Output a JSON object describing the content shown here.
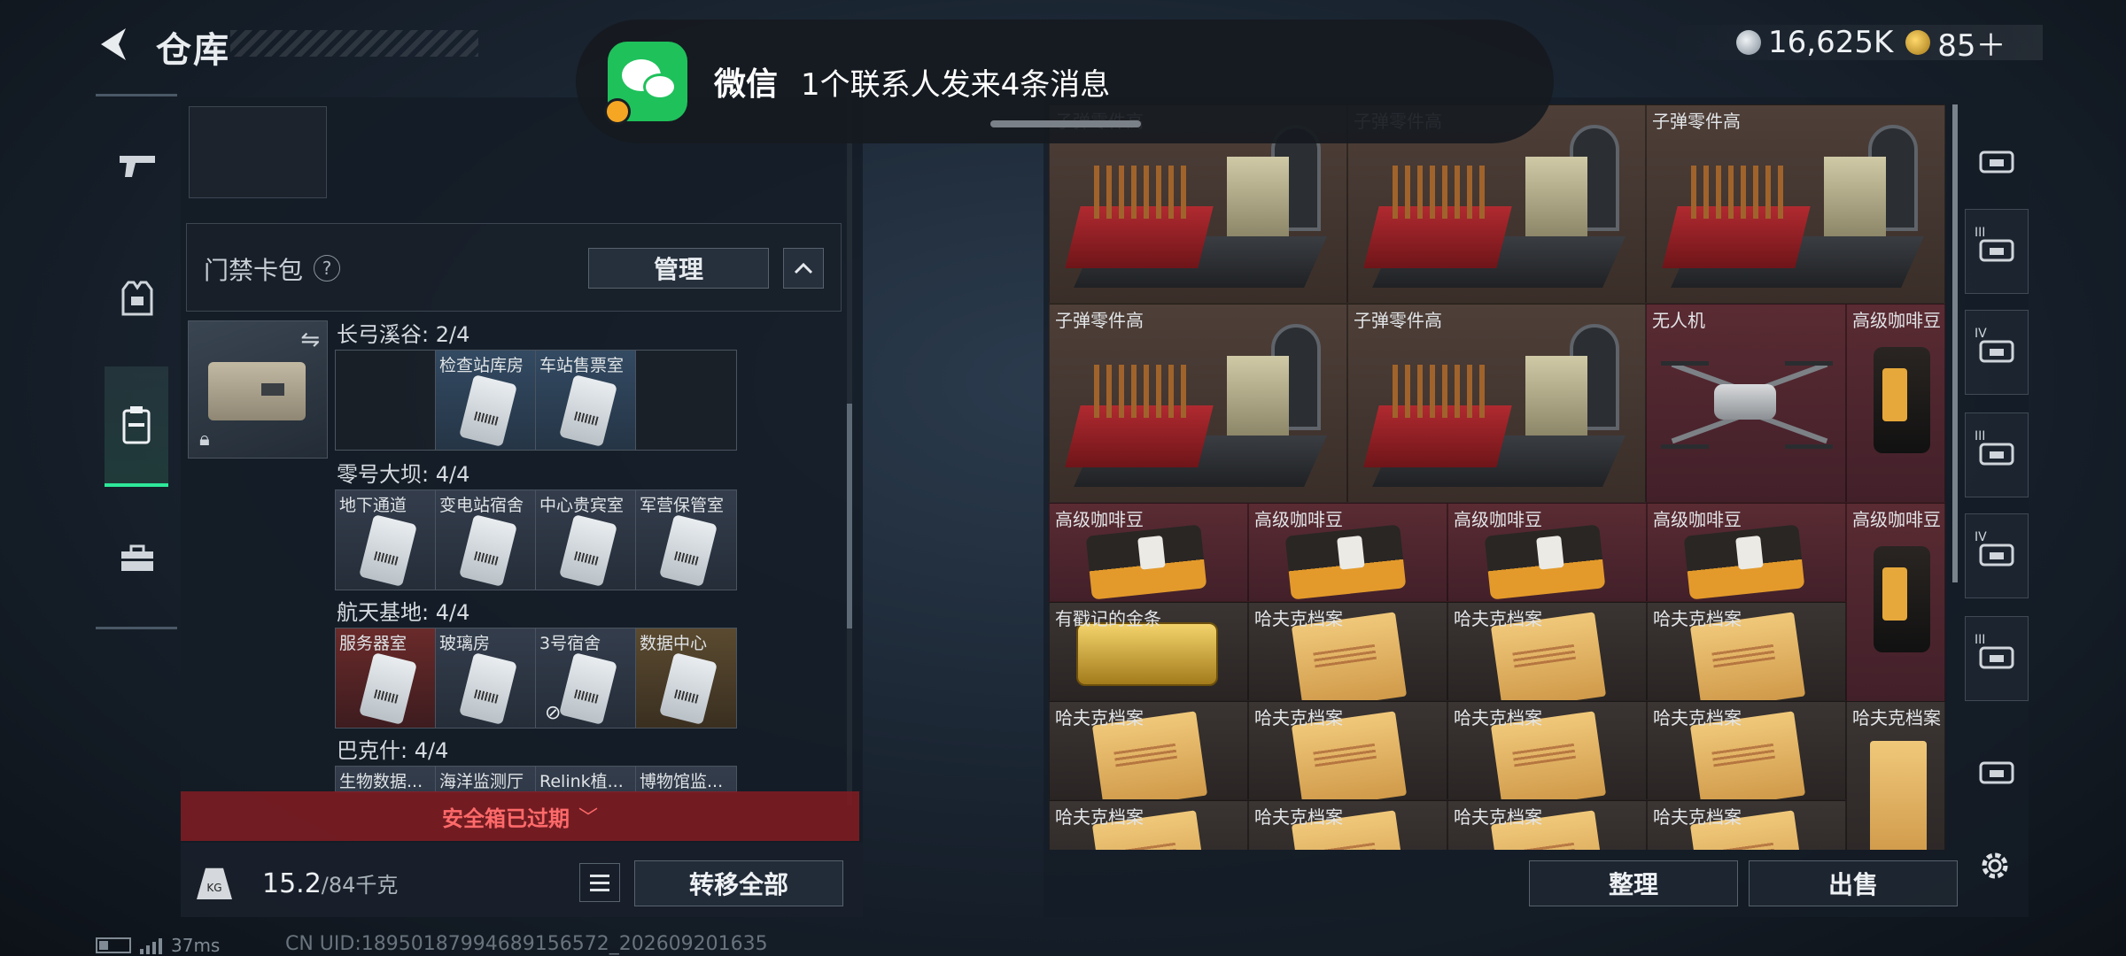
{
  "header": {
    "title": "仓库",
    "currencies": [
      {
        "icon": "silver-coin-icon",
        "value": "16,625K"
      },
      {
        "icon": "gold-coin-icon",
        "value": "85＋"
      }
    ]
  },
  "notification": {
    "app": "微信",
    "message": "1个联系人发来4条消息"
  },
  "keycase": {
    "title": "门禁卡包",
    "help": "?",
    "manage_label": "管理"
  },
  "maps": [
    {
      "title": "长弓溪谷: 2/4",
      "cards": [
        {
          "label": "",
          "style": "empty"
        },
        {
          "label": "检查站库房",
          "style": "blue"
        },
        {
          "label": "车站售票室",
          "style": "blue"
        },
        {
          "label": "",
          "style": "empty"
        }
      ]
    },
    {
      "title": "零号大坝: 4/4",
      "cards": [
        {
          "label": "地下通道",
          "style": "grey"
        },
        {
          "label": "变电站宿舍",
          "style": "grey"
        },
        {
          "label": "中心贵宾室",
          "style": "grey"
        },
        {
          "label": "军营保管室",
          "style": "grey"
        }
      ]
    },
    {
      "title": "航天基地: 4/4",
      "cards": [
        {
          "label": "服务器室",
          "style": "red"
        },
        {
          "label": "玻璃房",
          "style": "grey"
        },
        {
          "label": "3号宿舍",
          "style": "grey"
        },
        {
          "label": "数据中心",
          "style": "gold"
        }
      ]
    },
    {
      "title": "巴克什: 4/4",
      "cards": [
        {
          "label": "生物数据...",
          "style": "grey"
        },
        {
          "label": "海洋监测厅",
          "style": "grey"
        },
        {
          "label": "Relink植...",
          "style": "grey"
        },
        {
          "label": "博物馆监...",
          "style": "grey"
        }
      ]
    }
  ],
  "safebox": {
    "expired_text": "安全箱已过期"
  },
  "weight": {
    "current": "15.2",
    "max": "/84千克",
    "icon_text": "KG"
  },
  "actions": {
    "transfer_all": "转移全部",
    "sort": "整理",
    "sell": "出售"
  },
  "inventory": [
    {
      "label": "子弹零件高",
      "kind": "ammo"
    },
    {
      "label": "子弹零件高",
      "kind": "ammo"
    },
    {
      "label": "子弹零件高",
      "kind": "ammo"
    },
    {
      "label": "子弹零件高",
      "kind": "ammo"
    },
    {
      "label": "子弹零件高",
      "kind": "ammo"
    },
    {
      "label": "无人机",
      "kind": "drone"
    },
    {
      "label": "高级咖啡豆",
      "kind": "coffee-tall"
    },
    {
      "label": "高级咖啡豆",
      "kind": "coffee"
    },
    {
      "label": "高级咖啡豆",
      "kind": "coffee"
    },
    {
      "label": "高级咖啡豆",
      "kind": "coffee"
    },
    {
      "label": "高级咖啡豆",
      "kind": "coffee"
    },
    {
      "label": "高级咖啡豆",
      "kind": "coffee-tall"
    },
    {
      "label": "有戳记的金条",
      "kind": "gold"
    },
    {
      "label": "哈夫克档案",
      "kind": "folder"
    },
    {
      "label": "哈夫克档案",
      "kind": "folder"
    },
    {
      "label": "哈夫克档案",
      "kind": "folder"
    },
    {
      "label": "哈夫克档案",
      "kind": "folder"
    },
    {
      "label": "哈夫克档案",
      "kind": "folder"
    },
    {
      "label": "哈夫克档案",
      "kind": "folder"
    },
    {
      "label": "哈夫克档案",
      "kind": "folder"
    },
    {
      "label": "哈夫克档案",
      "kind": "folder-tall"
    },
    {
      "label": "哈夫克档案",
      "kind": "folder"
    },
    {
      "label": "哈夫克档案",
      "kind": "folder"
    },
    {
      "label": "哈夫克档案",
      "kind": "folder"
    },
    {
      "label": "哈夫克档案",
      "kind": "folder"
    }
  ],
  "rail": [
    {
      "icon": "dome-icon",
      "roman": ""
    },
    {
      "icon": "weapon-tier-icon",
      "roman": "III"
    },
    {
      "icon": "ammo-tier-icon",
      "roman": "IV"
    },
    {
      "icon": "armor-tier-icon",
      "roman": "III"
    },
    {
      "icon": "bag-tier-icon",
      "roman": "IV"
    },
    {
      "icon": "medkit-tier-icon",
      "roman": "III"
    },
    {
      "icon": "device-icon",
      "roman": ""
    }
  ],
  "status": {
    "ping": "37ms",
    "uid": "CN UID:18950187994689156572_202609201635"
  }
}
